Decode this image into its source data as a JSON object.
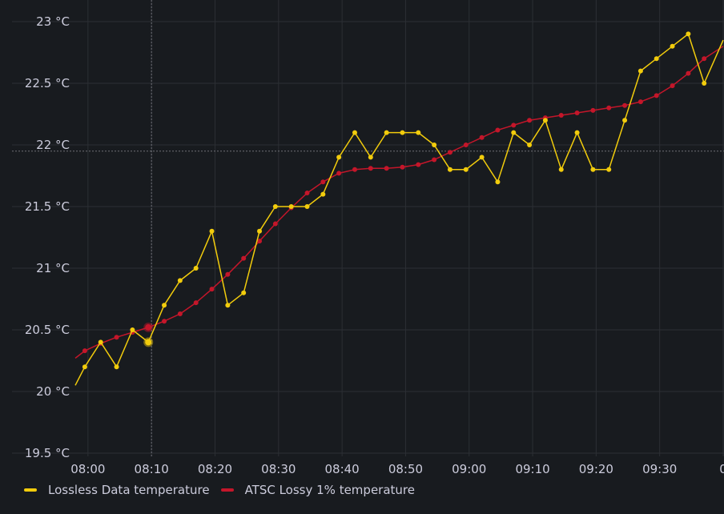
{
  "chart_data": {
    "type": "line",
    "x_ticks": [
      "08:00",
      "08:10",
      "08:20",
      "08:30",
      "08:40",
      "08:50",
      "09:00",
      "09:10",
      "09:20",
      "09:30",
      "0"
    ],
    "y_ticks": [
      "19.5 °C",
      "20 °C",
      "20.5 °C",
      "21 °C",
      "21.5 °C",
      "22 °C",
      "22.5 °C",
      "23 °C"
    ],
    "ylim": [
      19.5,
      23
    ],
    "xlim": [
      "07:58",
      "09:40"
    ],
    "grid": true,
    "legend_position": "bottom-left",
    "crosshair": {
      "x": "08:10",
      "y": 21.95
    },
    "series": [
      {
        "name": "Lossless Data temperature",
        "color": "#f2cc0c",
        "points": [
          [
            "07:58",
            20.05
          ],
          [
            "07:59:30",
            20.2
          ],
          [
            "08:02",
            20.4
          ],
          [
            "08:04:30",
            20.2
          ],
          [
            "08:07",
            20.5
          ],
          [
            "08:09:30",
            20.4
          ],
          [
            "08:12",
            20.7
          ],
          [
            "08:14:30",
            20.9
          ],
          [
            "08:17",
            21.0
          ],
          [
            "08:19:30",
            21.3
          ],
          [
            "08:22",
            20.7
          ],
          [
            "08:24:30",
            20.8
          ],
          [
            "08:27",
            21.3
          ],
          [
            "08:29:30",
            21.5
          ],
          [
            "08:32",
            21.5
          ],
          [
            "08:34:30",
            21.5
          ],
          [
            "08:37",
            21.6
          ],
          [
            "08:39:30",
            21.9
          ],
          [
            "08:42",
            22.1
          ],
          [
            "08:44:30",
            21.9
          ],
          [
            "08:47",
            22.1
          ],
          [
            "08:49:30",
            22.1
          ],
          [
            "08:52",
            22.1
          ],
          [
            "08:54:30",
            22.0
          ],
          [
            "08:57",
            21.8
          ],
          [
            "08:59:30",
            21.8
          ],
          [
            "09:02",
            21.9
          ],
          [
            "09:04:30",
            21.7
          ],
          [
            "09:07",
            22.1
          ],
          [
            "09:09:30",
            22.0
          ],
          [
            "09:12",
            22.2
          ],
          [
            "09:14:30",
            21.8
          ],
          [
            "09:17",
            22.1
          ],
          [
            "09:19:30",
            21.8
          ],
          [
            "09:22",
            21.8
          ],
          [
            "09:24:30",
            22.2
          ],
          [
            "09:27",
            22.6
          ],
          [
            "09:29:30",
            22.7
          ],
          [
            "09:32",
            22.8
          ],
          [
            "09:34:30",
            22.9
          ],
          [
            "09:37",
            22.5
          ],
          [
            "09:40",
            22.85
          ]
        ]
      },
      {
        "name": "ATSC Lossy 1% temperature",
        "color": "#c4162a",
        "points": [
          [
            "07:58",
            20.27
          ],
          [
            "07:59:30",
            20.33
          ],
          [
            "08:02",
            20.39
          ],
          [
            "08:04:30",
            20.44
          ],
          [
            "08:07",
            20.48
          ],
          [
            "08:09:30",
            20.52
          ],
          [
            "08:12",
            20.57
          ],
          [
            "08:14:30",
            20.63
          ],
          [
            "08:17",
            20.72
          ],
          [
            "08:19:30",
            20.83
          ],
          [
            "08:22",
            20.95
          ],
          [
            "08:24:30",
            21.08
          ],
          [
            "08:27",
            21.22
          ],
          [
            "08:29:30",
            21.36
          ],
          [
            "08:32",
            21.49
          ],
          [
            "08:34:30",
            21.61
          ],
          [
            "08:37",
            21.7
          ],
          [
            "08:39:30",
            21.77
          ],
          [
            "08:42",
            21.8
          ],
          [
            "08:44:30",
            21.81
          ],
          [
            "08:47",
            21.81
          ],
          [
            "08:49:30",
            21.82
          ],
          [
            "08:52",
            21.84
          ],
          [
            "08:54:30",
            21.88
          ],
          [
            "08:57",
            21.94
          ],
          [
            "08:59:30",
            22.0
          ],
          [
            "09:02",
            22.06
          ],
          [
            "09:04:30",
            22.12
          ],
          [
            "09:07",
            22.16
          ],
          [
            "09:09:30",
            22.2
          ],
          [
            "09:12",
            22.22
          ],
          [
            "09:14:30",
            22.24
          ],
          [
            "09:17",
            22.26
          ],
          [
            "09:19:30",
            22.28
          ],
          [
            "09:22",
            22.3
          ],
          [
            "09:24:30",
            22.32
          ],
          [
            "09:27",
            22.35
          ],
          [
            "09:29:30",
            22.4
          ],
          [
            "09:32",
            22.48
          ],
          [
            "09:34:30",
            22.58
          ],
          [
            "09:37",
            22.7
          ],
          [
            "09:40",
            22.8
          ]
        ]
      }
    ]
  }
}
